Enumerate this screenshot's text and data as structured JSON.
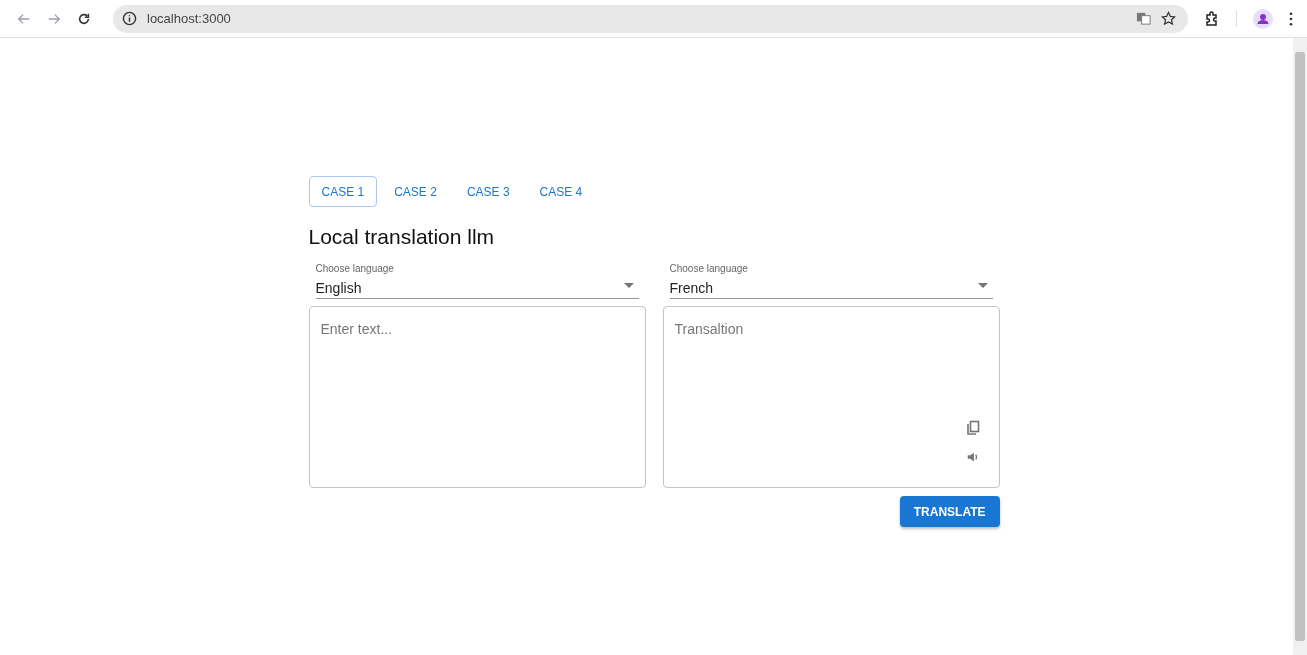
{
  "browser": {
    "url": "localhost:3000"
  },
  "tabs": [
    {
      "label": "CASE 1",
      "selected": true
    },
    {
      "label": "CASE 2",
      "selected": false
    },
    {
      "label": "CASE 3",
      "selected": false
    },
    {
      "label": "CASE 4",
      "selected": false
    }
  ],
  "heading": "Local translation llm",
  "source": {
    "label": "Choose language",
    "value": "English",
    "placeholder": "Enter text..."
  },
  "target": {
    "label": "Choose language",
    "value": "French",
    "placeholder": "Transaltion"
  },
  "translate_button": "TRANSLATE"
}
